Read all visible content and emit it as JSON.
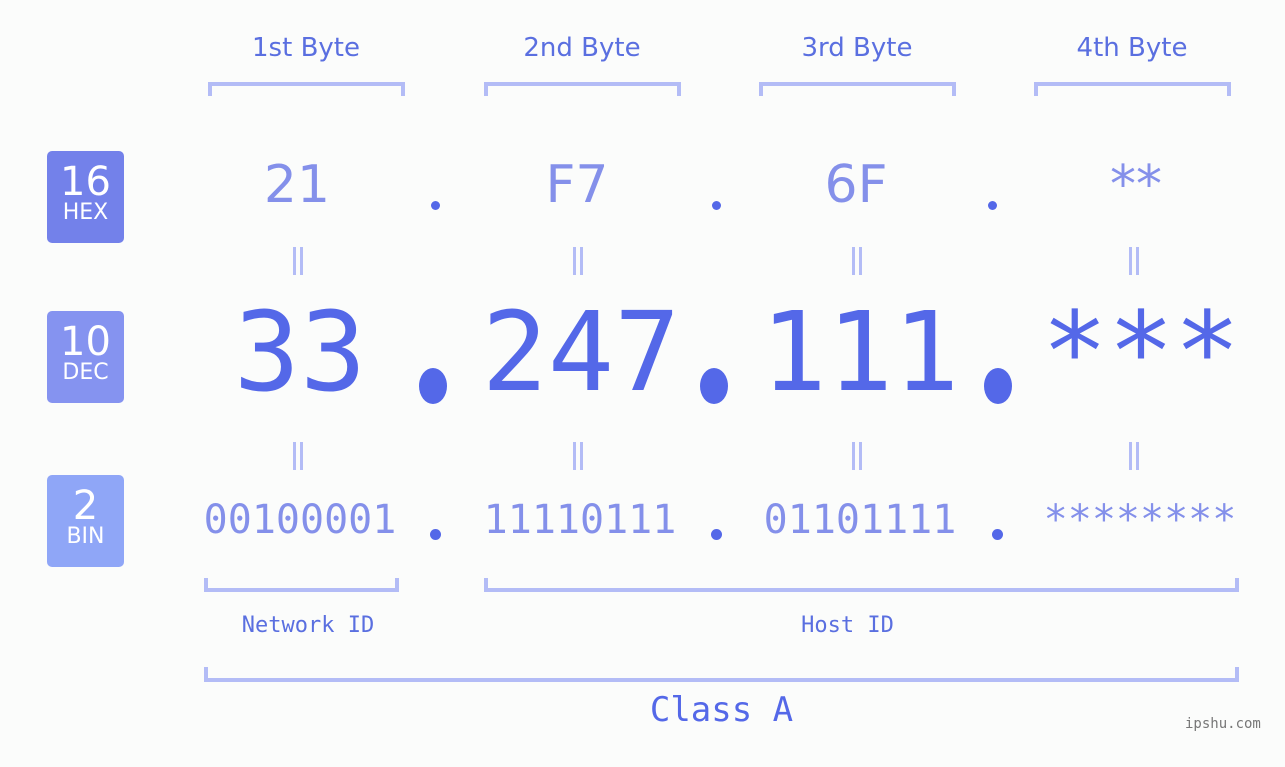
{
  "byte_headers": [
    "1st Byte",
    "2nd Byte",
    "3rd Byte",
    "4th Byte"
  ],
  "badges": {
    "hex": {
      "num": "16",
      "label": "HEX",
      "color": "#7381ea"
    },
    "dec": {
      "num": "10",
      "label": "DEC",
      "color": "#8593f0"
    },
    "bin": {
      "num": "2",
      "label": "BIN",
      "color": "#8fa6f7"
    }
  },
  "hex": [
    "21",
    "F7",
    "6F",
    "**"
  ],
  "dec": [
    "33",
    "247",
    "111",
    "***"
  ],
  "bin": [
    "00100001",
    "11110111",
    "01101111",
    "********"
  ],
  "network_id_label": "Network ID",
  "host_id_label": "Host ID",
  "class_label": "Class A",
  "watermark": "ipshu.com",
  "colors": {
    "accent": "#5468e8",
    "light": "#8490ea",
    "bracket": "#b3bcf6"
  }
}
